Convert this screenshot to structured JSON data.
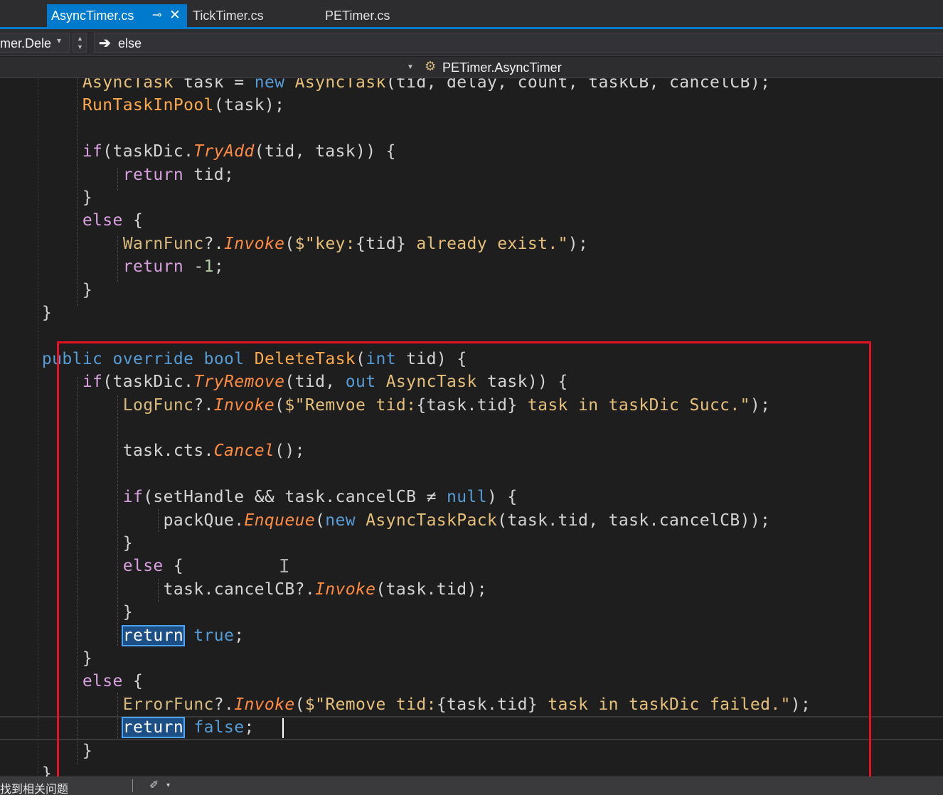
{
  "tabs": [
    {
      "label": "AsyncTimer.cs",
      "active": true,
      "pin_icon": "pin-icon",
      "close_icon": "close-icon"
    },
    {
      "label": "TickTimer.cs",
      "active": false
    },
    {
      "label": "PETimer.cs",
      "active": false
    }
  ],
  "navbar": {
    "member_label": "mer.Dele",
    "statement_label": "else",
    "arrow_icon": "right-arrow-icon",
    "caret_glyph": "▾",
    "arrow_glyph": "➔"
  },
  "context": {
    "class_label": "PETimer.AsyncTimer",
    "class_icon": "class-icon",
    "class_glyph": "⚙"
  },
  "status": {
    "text": "找到相关问题",
    "icon": "broom-icon",
    "icon_glyph": "✐",
    "caret_glyph": "▾"
  },
  "colors": {
    "accent": "#007acc",
    "highlight_box": "#e81123",
    "editor_bg": "#1e1e1e",
    "keyword": "#569cd6",
    "method": "#ff8c42"
  },
  "code_lines": [
    [
      {
        "t": "        "
      },
      {
        "t": "AsyncTask",
        "c": "type"
      },
      {
        "t": " "
      },
      {
        "t": "task",
        "c": "id"
      },
      {
        "t": " = "
      },
      {
        "t": "new",
        "c": "kw"
      },
      {
        "t": " "
      },
      {
        "t": "AsyncTask",
        "c": "type"
      },
      {
        "t": "(tid, delay, count, taskCB, cancelCB);"
      }
    ],
    [
      {
        "t": "        "
      },
      {
        "t": "RunTaskInPool",
        "c": "fn"
      },
      {
        "t": "(task);"
      }
    ],
    [],
    [
      {
        "t": "        "
      },
      {
        "t": "if",
        "c": "ctl"
      },
      {
        "t": "(taskDic."
      },
      {
        "t": "TryAdd",
        "c": "mi"
      },
      {
        "t": "(tid, task)) {"
      }
    ],
    [
      {
        "t": "            "
      },
      {
        "t": "return",
        "c": "ctl"
      },
      {
        "t": " tid;"
      }
    ],
    [
      {
        "t": "        }"
      }
    ],
    [
      {
        "t": "        "
      },
      {
        "t": "else",
        "c": "ctl"
      },
      {
        "t": " {"
      }
    ],
    [
      {
        "t": "            "
      },
      {
        "t": "WarnFunc",
        "c": "prop"
      },
      {
        "t": "?."
      },
      {
        "t": "Invoke",
        "c": "mi"
      },
      {
        "t": "("
      },
      {
        "t": "$\"key:",
        "c": "str"
      },
      {
        "t": "{tid}"
      },
      {
        "t": " already exist.\"",
        "c": "str"
      },
      {
        "t": ");"
      }
    ],
    [
      {
        "t": "            "
      },
      {
        "t": "return",
        "c": "ctl"
      },
      {
        "t": " -"
      },
      {
        "t": "1",
        "c": "num"
      },
      {
        "t": ";"
      }
    ],
    [
      {
        "t": "        }"
      }
    ],
    [
      {
        "t": "    }"
      }
    ],
    [],
    [
      {
        "t": "    "
      },
      {
        "t": "public",
        "c": "kw"
      },
      {
        "t": " "
      },
      {
        "t": "override",
        "c": "kw"
      },
      {
        "t": " "
      },
      {
        "t": "bool",
        "c": "kw"
      },
      {
        "t": " "
      },
      {
        "t": "DeleteTask",
        "c": "fn"
      },
      {
        "t": "("
      },
      {
        "t": "int",
        "c": "kw"
      },
      {
        "t": " tid) {"
      }
    ],
    [
      {
        "t": "        "
      },
      {
        "t": "if",
        "c": "ctl"
      },
      {
        "t": "(taskDic."
      },
      {
        "t": "TryRemove",
        "c": "mi"
      },
      {
        "t": "(tid, "
      },
      {
        "t": "out",
        "c": "kw"
      },
      {
        "t": " "
      },
      {
        "t": "AsyncTask",
        "c": "type"
      },
      {
        "t": " task)) {"
      }
    ],
    [
      {
        "t": "            "
      },
      {
        "t": "LogFunc",
        "c": "prop"
      },
      {
        "t": "?."
      },
      {
        "t": "Invoke",
        "c": "mi"
      },
      {
        "t": "("
      },
      {
        "t": "$\"Remvoe tid:",
        "c": "str"
      },
      {
        "t": "{task.tid}"
      },
      {
        "t": " task in taskDic Succ.\"",
        "c": "str"
      },
      {
        "t": ");"
      }
    ],
    [],
    [
      {
        "t": "            task.cts."
      },
      {
        "t": "Cancel",
        "c": "mi"
      },
      {
        "t": "();"
      }
    ],
    [],
    [
      {
        "t": "            "
      },
      {
        "t": "if",
        "c": "ctl"
      },
      {
        "t": "(setHandle && task.cancelCB ≠ "
      },
      {
        "t": "null",
        "c": "kw"
      },
      {
        "t": ") {"
      }
    ],
    [
      {
        "t": "                packQue."
      },
      {
        "t": "Enqueue",
        "c": "mi"
      },
      {
        "t": "("
      },
      {
        "t": "new",
        "c": "kw"
      },
      {
        "t": " "
      },
      {
        "t": "AsyncTaskPack",
        "c": "type"
      },
      {
        "t": "(task.tid, task.cancelCB));"
      }
    ],
    [
      {
        "t": "            }"
      }
    ],
    [
      {
        "t": "            "
      },
      {
        "t": "else",
        "c": "ctl"
      },
      {
        "t": " {"
      }
    ],
    [
      {
        "t": "                task.cancelCB?."
      },
      {
        "t": "Invoke",
        "c": "mi"
      },
      {
        "t": "(task.tid);"
      }
    ],
    [
      {
        "t": "            }"
      }
    ],
    [
      {
        "t": "            "
      },
      {
        "t": "return",
        "c": "hl"
      },
      {
        "t": " "
      },
      {
        "t": "true",
        "c": "kw"
      },
      {
        "t": ";"
      }
    ],
    [
      {
        "t": "        }"
      }
    ],
    [
      {
        "t": "        "
      },
      {
        "t": "else",
        "c": "ctl"
      },
      {
        "t": " {"
      }
    ],
    [
      {
        "t": "            "
      },
      {
        "t": "ErrorFunc",
        "c": "prop"
      },
      {
        "t": "?."
      },
      {
        "t": "Invoke",
        "c": "mi"
      },
      {
        "t": "("
      },
      {
        "t": "$\"Remove tid:",
        "c": "str"
      },
      {
        "t": "{task.tid}"
      },
      {
        "t": " task in taskDic failed.\"",
        "c": "str"
      },
      {
        "t": ");"
      }
    ],
    [
      {
        "t": "            "
      },
      {
        "t": "return",
        "c": "hl"
      },
      {
        "t": " "
      },
      {
        "t": "false",
        "c": "kw"
      },
      {
        "t": ";"
      }
    ],
    [
      {
        "t": "        }"
      }
    ],
    [
      {
        "t": "    }"
      }
    ]
  ]
}
